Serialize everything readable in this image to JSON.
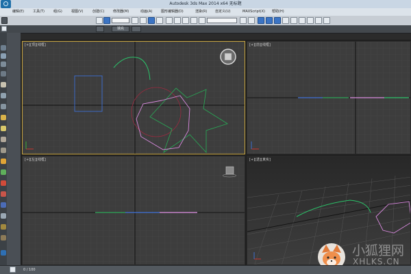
{
  "window": {
    "title": "Autodesk 3ds Max 2014 x64    无标题"
  },
  "menu": {
    "items": [
      {
        "label": "编辑(E)"
      },
      {
        "label": "工具(T)"
      },
      {
        "label": "组(G)"
      },
      {
        "label": "视图(V)"
      },
      {
        "label": "创建(C)"
      },
      {
        "label": "修改器(M)"
      },
      {
        "label": "动画(A)"
      },
      {
        "label": "图形编辑器(D)"
      },
      {
        "label": "渲染(R)"
      },
      {
        "label": "自定义(U)"
      },
      {
        "label": "MAXScript(X)"
      },
      {
        "label": "帮助(H)"
      }
    ]
  },
  "toolbar2": {
    "selection_label": "填充"
  },
  "viewports": {
    "top": {
      "label": "[+][顶][线框]"
    },
    "front": {
      "label": "[+][前][线框]"
    },
    "left": {
      "label": "[+][左][线框]"
    },
    "perspective": {
      "label": "[+][透][真实]"
    }
  },
  "watermark": {
    "text_cn": "小狐狸网",
    "text_en": "XHLKS.CN"
  },
  "colors": {
    "arc": "#2bc46a",
    "rectangle": "#3d6fd6",
    "nonagon": "#d98adf",
    "star": "#2aa455",
    "circle": "#9c2a3f",
    "active_border": "#c9a640"
  },
  "status": {
    "text": "0 / 100"
  }
}
